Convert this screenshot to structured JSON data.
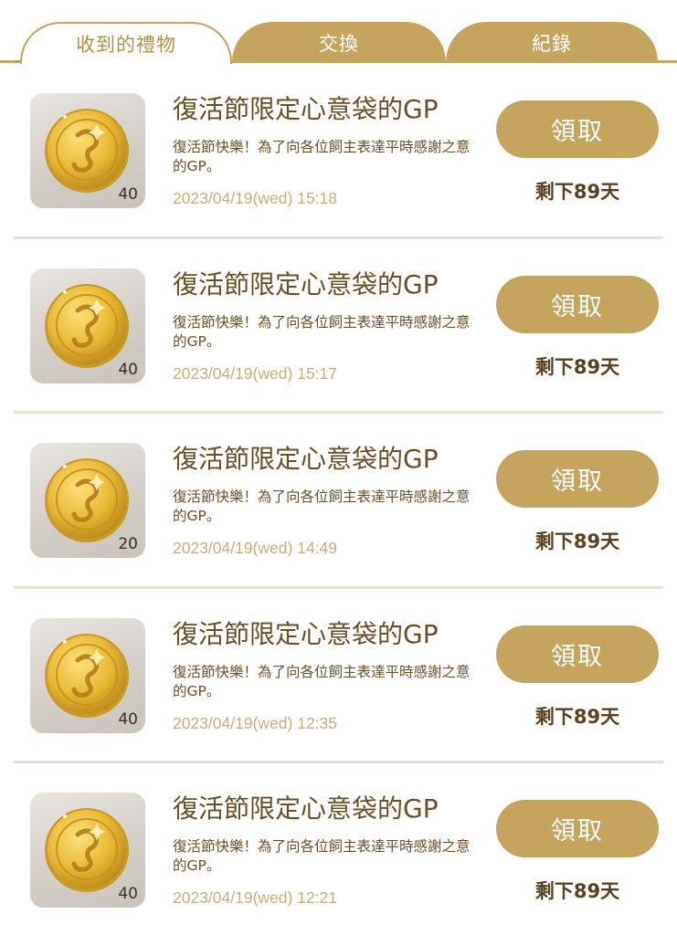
{
  "tabs": [
    {
      "label": "收到的禮物",
      "active": true
    },
    {
      "label": "交換",
      "active": false
    },
    {
      "label": "紀錄",
      "active": false
    }
  ],
  "colors": {
    "accent": "#c5a45e",
    "title_text": "#6b4f24",
    "timestamp_text": "#c8ae7a",
    "divider": "#ece3cf"
  },
  "gifts": [
    {
      "icon": "gold-coin-icon",
      "count": "40",
      "title": "復活節限定心意袋的GP",
      "description": "復活節快樂！為了向各位飼主表達平時感謝之意的GP。",
      "timestamp": "2023/04/19(wed) 15:18",
      "button_label": "領取",
      "days_left": "剩下89天"
    },
    {
      "icon": "gold-coin-icon",
      "count": "40",
      "title": "復活節限定心意袋的GP",
      "description": "復活節快樂！為了向各位飼主表達平時感謝之意的GP。",
      "timestamp": "2023/04/19(wed) 15:17",
      "button_label": "領取",
      "days_left": "剩下89天"
    },
    {
      "icon": "gold-coin-icon",
      "count": "20",
      "title": "復活節限定心意袋的GP",
      "description": "復活節快樂！為了向各位飼主表達平時感謝之意的GP。",
      "timestamp": "2023/04/19(wed) 14:49",
      "button_label": "領取",
      "days_left": "剩下89天"
    },
    {
      "icon": "gold-coin-icon",
      "count": "40",
      "title": "復活節限定心意袋的GP",
      "description": "復活節快樂！為了向各位飼主表達平時感謝之意的GP。",
      "timestamp": "2023/04/19(wed) 12:35",
      "button_label": "領取",
      "days_left": "剩下89天"
    },
    {
      "icon": "gold-coin-icon",
      "count": "40",
      "title": "復活節限定心意袋的GP",
      "description": "復活節快樂！為了向各位飼主表達平時感謝之意的GP。",
      "timestamp": "2023/04/19(wed) 12:21",
      "button_label": "領取",
      "days_left": "剩下89天"
    }
  ]
}
